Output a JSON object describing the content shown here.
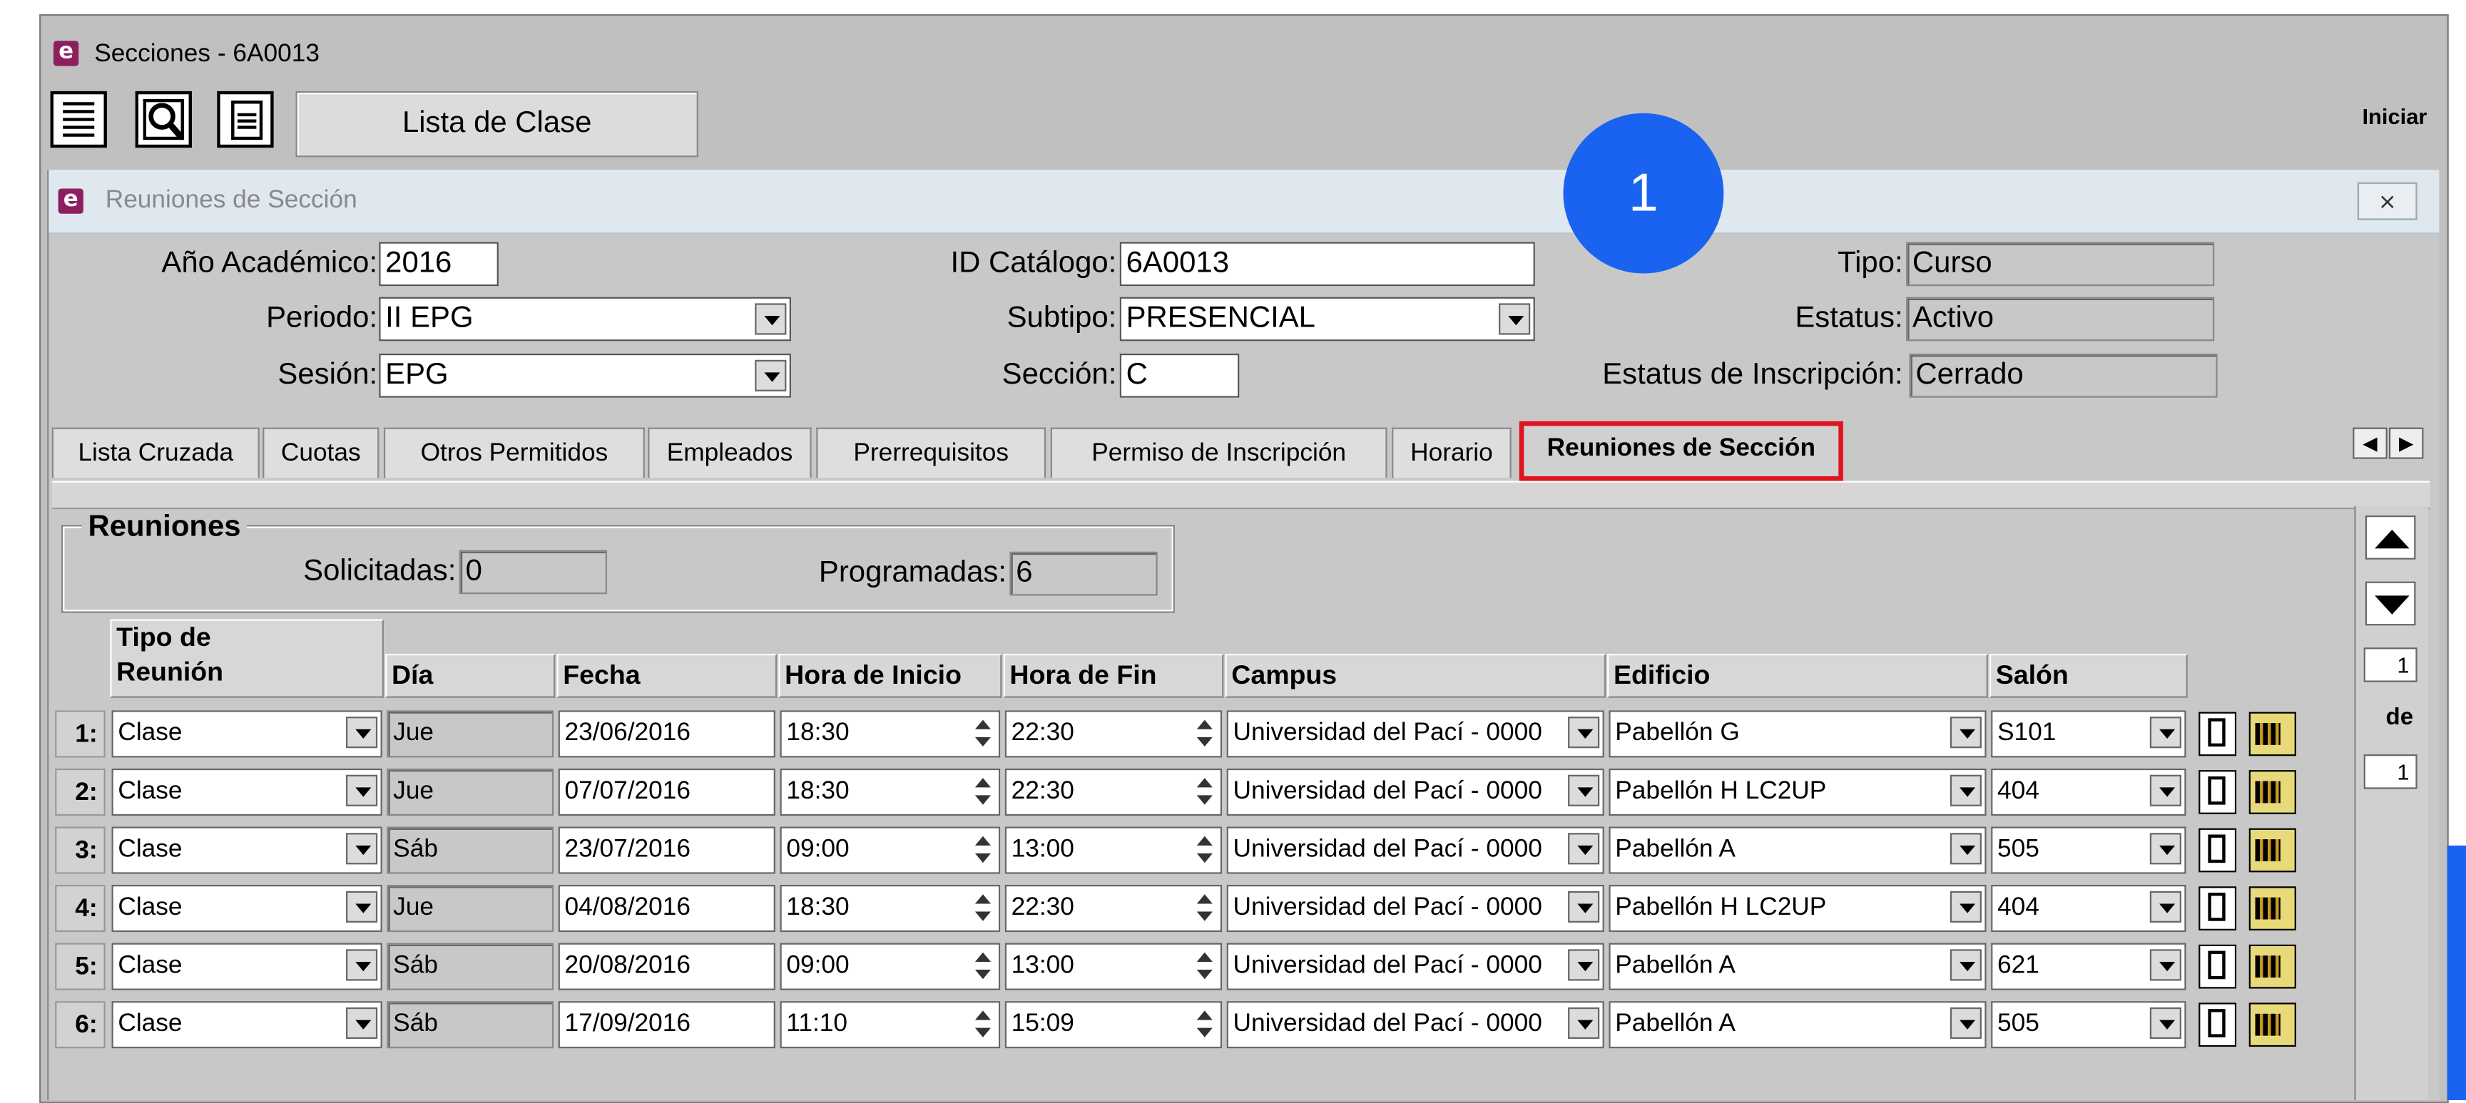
{
  "window": {
    "title": "Secciones -  6A0013",
    "iniciar": "Iniciar"
  },
  "toolbar": {
    "lista_clase": "Lista de Clase"
  },
  "dialog": {
    "title": "Reuniones de Sección",
    "close_label": "⨯"
  },
  "badge": "1",
  "form": {
    "anio_label": "Año Académico:",
    "anio_value": "2016",
    "periodo_label": "Periodo:",
    "periodo_value": "II EPG",
    "sesion_label": "Sesión:",
    "sesion_value": "EPG",
    "catalogo_label": "ID Catálogo:",
    "catalogo_value": "6A0013",
    "subtipo_label": "Subtipo:",
    "subtipo_value": "PRESENCIAL",
    "seccion_label": "Sección:",
    "seccion_value": "C",
    "tipo_label": "Tipo:",
    "tipo_value": "Curso",
    "estatus_label": "Estatus:",
    "estatus_value": "Activo",
    "inscripcion_label": "Estatus de Inscripción:",
    "inscripcion_value": "Cerrado"
  },
  "tabs": [
    "Lista Cruzada",
    "Cuotas",
    "Otros Permitidos",
    "Empleados",
    "Prerrequisitos",
    "Permiso de Inscripción",
    "Horario",
    "Reuniones de Sección"
  ],
  "reuniones": {
    "title": "Reuniones",
    "solicitadas_label": "Solicitadas:",
    "solicitadas_value": "0",
    "programadas_label": "Programadas:",
    "programadas_value": "6"
  },
  "table": {
    "headers": [
      "Tipo de\nReunión",
      "Día",
      "Fecha",
      "Hora de Inicio",
      "Hora de Fin",
      "Campus",
      "Edificio",
      "Salón"
    ],
    "rows": [
      {
        "n": "1:",
        "tipo": "Clase",
        "dia": "Jue",
        "fecha": "23/06/2016",
        "inicio": "18:30",
        "fin": "22:30",
        "campus": "Universidad del Pací - 0000",
        "edificio": "Pabellón G",
        "salon": "S101"
      },
      {
        "n": "2:",
        "tipo": "Clase",
        "dia": "Jue",
        "fecha": "07/07/2016",
        "inicio": "18:30",
        "fin": "22:30",
        "campus": "Universidad del Pací - 0000",
        "edificio": "Pabellón H LC2UP",
        "salon": "404"
      },
      {
        "n": "3:",
        "tipo": "Clase",
        "dia": "Sáb",
        "fecha": "23/07/2016",
        "inicio": "09:00",
        "fin": "13:00",
        "campus": "Universidad del Pací - 0000",
        "edificio": "Pabellón A",
        "salon": "505"
      },
      {
        "n": "4:",
        "tipo": "Clase",
        "dia": "Jue",
        "fecha": "04/08/2016",
        "inicio": "18:30",
        "fin": "22:30",
        "campus": "Universidad del Pací - 0000",
        "edificio": "Pabellón H LC2UP",
        "salon": "404"
      },
      {
        "n": "5:",
        "tipo": "Clase",
        "dia": "Sáb",
        "fecha": "20/08/2016",
        "inicio": "09:00",
        "fin": "13:00",
        "campus": "Universidad del Pací - 0000",
        "edificio": "Pabellón A",
        "salon": "621"
      },
      {
        "n": "6:",
        "tipo": "Clase",
        "dia": "Sáb",
        "fecha": "17/09/2016",
        "inicio": "11:10",
        "fin": "15:09",
        "campus": "Universidad del Pací - 0000",
        "edificio": "Pabellón A",
        "salon": "505"
      }
    ]
  },
  "pager": {
    "current": "1",
    "of_label": "de",
    "total": "1"
  }
}
